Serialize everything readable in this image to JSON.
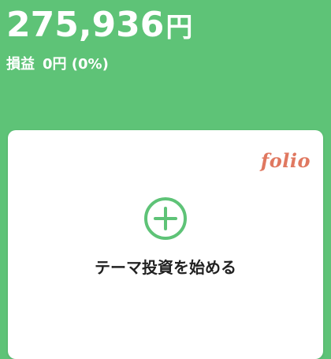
{
  "summary": {
    "total_value": "275,936",
    "total_unit": "円",
    "profit_label": "損益",
    "profit_value": "0円 (0%)"
  },
  "card": {
    "brand": "folio",
    "action_label": "テーマ投資を始める",
    "action_icon": "plus-circle-icon"
  },
  "colors": {
    "background": "#5ec377",
    "accent": "#5ec377",
    "brand": "#e07860",
    "text_dark": "#222222"
  }
}
